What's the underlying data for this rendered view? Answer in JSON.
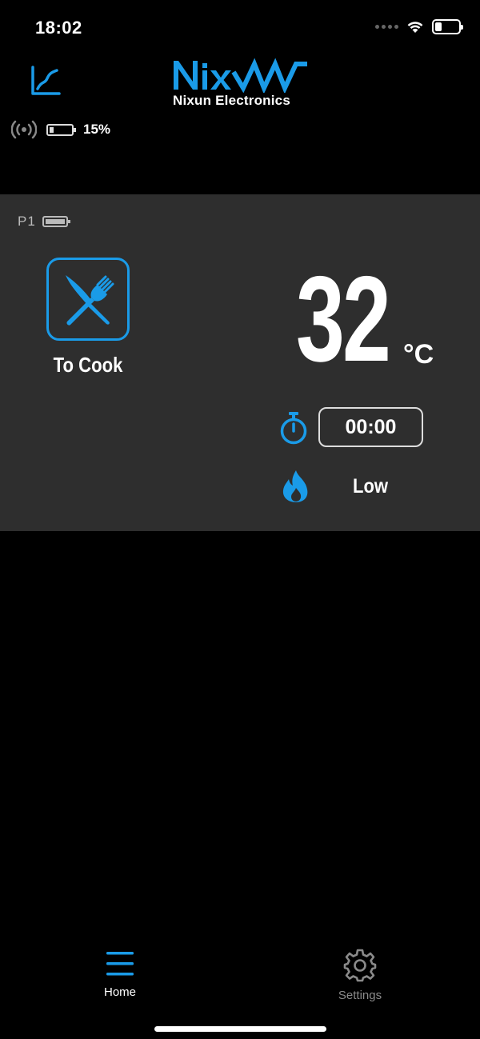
{
  "status_bar": {
    "time": "18:02"
  },
  "header": {
    "brand_name": "Nixun",
    "brand_subtitle": "Nixun Electronics",
    "device_battery": "15%"
  },
  "probe": {
    "label": "P1",
    "food_label": "To Cook",
    "temperature": "32",
    "unit": "°C",
    "timer": "00:00",
    "heat_level": "Low"
  },
  "tabs": [
    {
      "label": "Home",
      "active": true
    },
    {
      "label": "Settings",
      "active": false
    }
  ],
  "colors": {
    "accent": "#1a9be8",
    "card": "#2e2e2e",
    "background": "#000000"
  },
  "icons": [
    "chart-icon",
    "signal-icon",
    "battery-icon",
    "food-icon",
    "timer-icon",
    "flame-icon",
    "home-menu-icon",
    "gear-icon"
  ]
}
